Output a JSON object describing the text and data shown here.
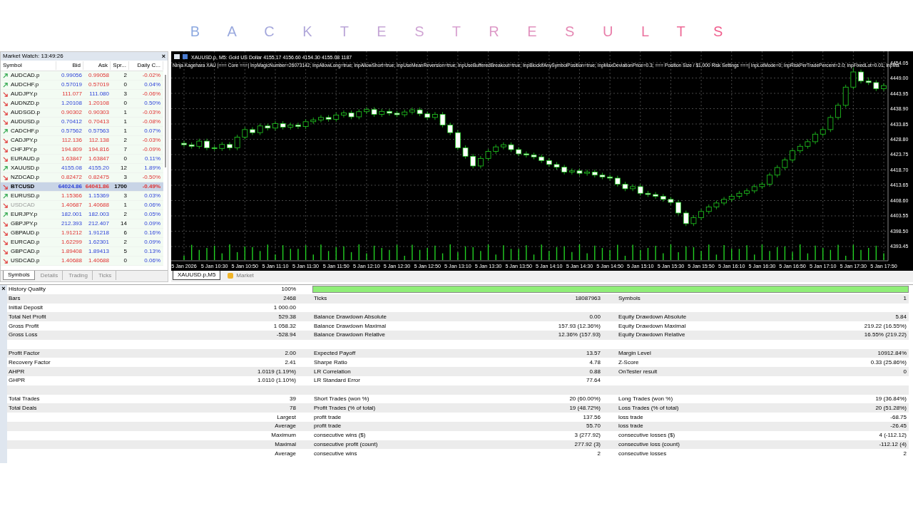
{
  "page_title": "B A C K T E S T R E S U L T S",
  "market_watch": {
    "title": "Market Watch: 13:49:26",
    "close": "×",
    "columns": [
      "Symbol",
      "Bid",
      "Ask",
      "Spr...",
      "Daily C..."
    ],
    "rows": [
      {
        "symbol": "AUDCAD.p",
        "bid": "0.99056",
        "ask": "0.99058",
        "spread": "2",
        "change": "-0.02%",
        "trend_up": true,
        "bid_up": true,
        "ask_up": false,
        "change_up": false,
        "selected": false,
        "dimmed": false
      },
      {
        "symbol": "AUDCHF.p",
        "bid": "0.57019",
        "ask": "0.57019",
        "spread": "0",
        "change": "0.04%",
        "trend_up": true,
        "bid_up": true,
        "ask_up": false,
        "change_up": true,
        "selected": false,
        "dimmed": false
      },
      {
        "symbol": "AUDJPY.p",
        "bid": "111.077",
        "ask": "111.080",
        "spread": "3",
        "change": "-0.06%",
        "trend_up": false,
        "bid_up": false,
        "ask_up": true,
        "change_up": false,
        "selected": false,
        "dimmed": false
      },
      {
        "symbol": "AUDNZD.p",
        "bid": "1.20108",
        "ask": "1.20108",
        "spread": "0",
        "change": "0.50%",
        "trend_up": false,
        "bid_up": true,
        "ask_up": false,
        "change_up": true,
        "selected": false,
        "dimmed": false
      },
      {
        "symbol": "AUDSGD.p",
        "bid": "0.90302",
        "ask": "0.90303",
        "spread": "1",
        "change": "-0.03%",
        "trend_up": false,
        "bid_up": false,
        "ask_up": false,
        "change_up": false,
        "selected": false,
        "dimmed": false
      },
      {
        "symbol": "AUDUSD.p",
        "bid": "0.70412",
        "ask": "0.70413",
        "spread": "1",
        "change": "-0.08%",
        "trend_up": false,
        "bid_up": true,
        "ask_up": false,
        "change_up": false,
        "selected": false,
        "dimmed": false
      },
      {
        "symbol": "CADCHF.p",
        "bid": "0.57562",
        "ask": "0.57563",
        "spread": "1",
        "change": "0.07%",
        "trend_up": true,
        "bid_up": true,
        "ask_up": true,
        "change_up": true,
        "selected": false,
        "dimmed": false
      },
      {
        "symbol": "CADJPY.p",
        "bid": "112.136",
        "ask": "112.138",
        "spread": "2",
        "change": "-0.03%",
        "trend_up": false,
        "bid_up": false,
        "ask_up": false,
        "change_up": false,
        "selected": false,
        "dimmed": false
      },
      {
        "symbol": "CHFJPY.p",
        "bid": "194.809",
        "ask": "194.816",
        "spread": "7",
        "change": "-0.09%",
        "trend_up": false,
        "bid_up": false,
        "ask_up": false,
        "change_up": false,
        "selected": false,
        "dimmed": false
      },
      {
        "symbol": "EURAUD.p",
        "bid": "1.63847",
        "ask": "1.63847",
        "spread": "0",
        "change": "0.11%",
        "trend_up": false,
        "bid_up": false,
        "ask_up": false,
        "change_up": true,
        "selected": false,
        "dimmed": false
      },
      {
        "symbol": "XAUUSD.p",
        "bid": "4155.08",
        "ask": "4155.20",
        "spread": "12",
        "change": "1.89%",
        "trend_up": true,
        "bid_up": true,
        "ask_up": true,
        "change_up": true,
        "selected": false,
        "dimmed": false
      },
      {
        "symbol": "NZDCAD.p",
        "bid": "0.82472",
        "ask": "0.82475",
        "spread": "3",
        "change": "-0.50%",
        "trend_up": false,
        "bid_up": false,
        "ask_up": false,
        "change_up": false,
        "selected": false,
        "dimmed": false
      },
      {
        "symbol": "BTCUSD",
        "bid": "64024.86",
        "ask": "64041.86",
        "spread": "1700",
        "change": "-0.49%",
        "trend_up": false,
        "bid_up": true,
        "ask_up": false,
        "change_up": false,
        "selected": true,
        "dimmed": false
      },
      {
        "symbol": "EURUSD.p",
        "bid": "1.15366",
        "ask": "1.15369",
        "spread": "3",
        "change": "0.03%",
        "trend_up": true,
        "bid_up": false,
        "ask_up": true,
        "change_up": true,
        "selected": false,
        "dimmed": false
      },
      {
        "symbol": "USDCAD",
        "bid": "1.40687",
        "ask": "1.40688",
        "spread": "1",
        "change": "0.06%",
        "trend_up": false,
        "bid_up": false,
        "ask_up": false,
        "change_up": true,
        "selected": false,
        "dimmed": true
      },
      {
        "symbol": "EURJPY.p",
        "bid": "182.001",
        "ask": "182.003",
        "spread": "2",
        "change": "0.05%",
        "trend_up": true,
        "bid_up": true,
        "ask_up": true,
        "change_up": true,
        "selected": false,
        "dimmed": false
      },
      {
        "symbol": "GBPJPY.p",
        "bid": "212.393",
        "ask": "212.407",
        "spread": "14",
        "change": "0.09%",
        "trend_up": false,
        "bid_up": true,
        "ask_up": true,
        "change_up": true,
        "selected": false,
        "dimmed": false
      },
      {
        "symbol": "GBPAUD.p",
        "bid": "1.91212",
        "ask": "1.91218",
        "spread": "6",
        "change": "0.16%",
        "trend_up": false,
        "bid_up": false,
        "ask_up": true,
        "change_up": true,
        "selected": false,
        "dimmed": false
      },
      {
        "symbol": "EURCAD.p",
        "bid": "1.62299",
        "ask": "1.62301",
        "spread": "2",
        "change": "0.09%",
        "trend_up": false,
        "bid_up": false,
        "ask_up": true,
        "change_up": true,
        "selected": false,
        "dimmed": false
      },
      {
        "symbol": "GBPCAD.p",
        "bid": "1.89408",
        "ask": "1.89413",
        "spread": "5",
        "change": "0.13%",
        "trend_up": false,
        "bid_up": false,
        "ask_up": true,
        "change_up": true,
        "selected": false,
        "dimmed": false
      },
      {
        "symbol": "USDCAD.p",
        "bid": "1.40688",
        "ask": "1.40688",
        "spread": "0",
        "change": "0.06%",
        "trend_up": false,
        "bid_up": false,
        "ask_up": false,
        "change_up": true,
        "selected": false,
        "dimmed": false
      }
    ],
    "tabs": [
      {
        "label": "Symbols",
        "selected": true
      },
      {
        "label": "Details",
        "selected": false
      },
      {
        "label": "Trading",
        "selected": false
      },
      {
        "label": "Ticks",
        "selected": false
      }
    ]
  },
  "chart": {
    "header": "XAUUSD.p, M5:  Gold US Dollar  4155.17 4156.60 4154.30 4155.08  1187",
    "params": "Ninja Kagehara XAU |=== Core ===| InpMagicNumber=26073142; InpAllowLong=true; InpAllowShort=true; InpUseMeanReversion=true; InpUseBufferedBreakout=true; InpBlockIfAnySymbolPosition=true; InpMaxDeviationPrice=0.3; === Position Size / $1,000 Risk Settings ===| InpLotMode=0; InpRiskPerTradePercent=2.0; InpFixedLot=0.01; InpMa",
    "chart_data": {
      "type": "candlestick",
      "grid": true,
      "ylim": [
        4388.75,
        4457.81
      ],
      "categories": [
        "5 Jan 2026",
        null,
        null,
        null,
        "5 Jan 10:30",
        null,
        null,
        null,
        "5 Jan 10:50",
        null,
        null,
        null,
        "5 Jan 11:10",
        null,
        null,
        null,
        "5 Jan 11:30",
        null,
        null,
        null,
        "5 Jan 11:50",
        null,
        null,
        null,
        "5 Jan 12:10",
        null,
        null,
        null,
        "5 Jan 12:30",
        null,
        null,
        null,
        "5 Jan 12:50",
        null,
        null,
        null,
        "5 Jan 13:10",
        null,
        null,
        null,
        "5 Jan 13:30",
        null,
        null,
        null,
        "5 Jan 13:50",
        null,
        null,
        null,
        "5 Jan 14:10",
        null,
        null,
        null,
        "5 Jan 14:30",
        null,
        null,
        null,
        "5 Jan 14:50",
        null,
        null,
        null,
        "5 Jan 15:10",
        null,
        null,
        null,
        "5 Jan 15:30",
        null,
        null,
        null,
        "5 Jan 15:50",
        null,
        null,
        null,
        "5 Jan 16:10",
        null,
        null,
        null,
        "5 Jan 16:30",
        null,
        null,
        null,
        "5 Jan 16:50",
        null,
        null,
        null,
        "5 Jan 17:10",
        null,
        null,
        null,
        "5 Jan 17:30",
        null,
        null,
        null,
        "5 Jan 17:50"
      ],
      "yticks": [
        {
          "value": 4454.05,
          "label": "4454.05"
        },
        {
          "value": 4449.0,
          "label": "4449.00"
        },
        {
          "value": 4443.95,
          "label": "4443.95"
        },
        {
          "value": 4438.9,
          "label": "4438.90"
        },
        {
          "value": 4433.85,
          "label": "4433.85"
        },
        {
          "value": 4428.8,
          "label": "4428.80"
        },
        {
          "value": 4423.75,
          "label": "4423.75"
        },
        {
          "value": 4418.7,
          "label": "4418.70"
        },
        {
          "value": 4413.65,
          "label": "4413.65"
        },
        {
          "value": 4408.6,
          "label": "4408.60"
        },
        {
          "value": 4403.55,
          "label": "4403.55"
        },
        {
          "value": 4398.5,
          "label": "4398.50"
        },
        {
          "value": 4393.45,
          "label": "4393.45"
        }
      ],
      "ohlc": [
        [
          4427.5,
          4428.3,
          4426.2,
          4427.0
        ],
        [
          4427.0,
          4427.8,
          4425.7,
          4426.5
        ],
        [
          4426.5,
          4429.0,
          4425.7,
          4428.2
        ],
        [
          4428.2,
          4429.0,
          4425.2,
          4426.0
        ],
        [
          4426.0,
          4426.8,
          4425.0,
          4425.8
        ],
        [
          4425.8,
          4427.9,
          4425.0,
          4427.1
        ],
        [
          4427.1,
          4427.9,
          4425.2,
          4426.0
        ],
        [
          4426.0,
          4430.3,
          4425.2,
          4429.5
        ],
        [
          4429.5,
          4432.8,
          4428.7,
          4432.0
        ],
        [
          4432.0,
          4432.8,
          4430.2,
          4431.0
        ],
        [
          4431.0,
          4434.0,
          4430.2,
          4433.2
        ],
        [
          4433.2,
          4434.0,
          4431.7,
          4432.5
        ],
        [
          4432.5,
          4434.8,
          4431.7,
          4434.0
        ],
        [
          4434.0,
          4434.8,
          4432.0,
          4432.8
        ],
        [
          4432.8,
          4434.3,
          4432.0,
          4433.5
        ],
        [
          4433.5,
          4434.3,
          4432.2,
          4433.0
        ],
        [
          4433.0,
          4435.4,
          4432.2,
          4434.6
        ],
        [
          4434.6,
          4436.0,
          4433.8,
          4435.2
        ],
        [
          4435.2,
          4436.8,
          4434.4,
          4436.0
        ],
        [
          4436.0,
          4436.8,
          4434.6,
          4435.4
        ],
        [
          4435.4,
          4437.6,
          4434.6,
          4436.8
        ],
        [
          4436.8,
          4438.3,
          4436.0,
          4437.5
        ],
        [
          4437.5,
          4438.3,
          4435.4,
          4436.2
        ],
        [
          4436.2,
          4438.7,
          4435.4,
          4437.9
        ],
        [
          4437.9,
          4439.4,
          4437.1,
          4438.6
        ],
        [
          4438.6,
          4439.4,
          4436.2,
          4437.0
        ],
        [
          4437.0,
          4438.8,
          4436.2,
          4438.0
        ],
        [
          4438.0,
          4438.8,
          4436.6,
          4437.4
        ],
        [
          4437.4,
          4438.2,
          4436.1,
          4436.9
        ],
        [
          4436.9,
          4438.6,
          4436.1,
          4437.8
        ],
        [
          4437.8,
          4439.3,
          4437.0,
          4438.5
        ],
        [
          4438.5,
          4439.3,
          4436.4,
          4437.2
        ],
        [
          4437.2,
          4438.0,
          4435.2,
          4436.0
        ],
        [
          4436.0,
          4437.8,
          4435.2,
          4437.0
        ],
        [
          4437.0,
          4437.8,
          4432.7,
          4433.5
        ],
        [
          4433.5,
          4434.3,
          4430.2,
          4431.0
        ],
        [
          4431.0,
          4431.8,
          4425.2,
          4426.0
        ],
        [
          4426.0,
          4426.8,
          4422.4,
          4423.2
        ],
        [
          4423.2,
          4424.0,
          4419.2,
          4420.0
        ],
        [
          4420.0,
          4423.3,
          4419.2,
          4422.5
        ],
        [
          4422.5,
          4425.6,
          4421.7,
          4424.8
        ],
        [
          4424.8,
          4427.1,
          4424.0,
          4426.3
        ],
        [
          4426.3,
          4427.8,
          4425.5,
          4427.0
        ],
        [
          4427.0,
          4427.8,
          4424.6,
          4425.4
        ],
        [
          4425.4,
          4426.2,
          4423.2,
          4424.0
        ],
        [
          4424.0,
          4424.8,
          4422.8,
          4423.6
        ],
        [
          4423.6,
          4424.4,
          4422.2,
          4423.0
        ],
        [
          4423.0,
          4423.8,
          4421.0,
          4421.8
        ],
        [
          4421.8,
          4422.6,
          4419.7,
          4420.5
        ],
        [
          4420.5,
          4421.3,
          4418.8,
          4419.6
        ],
        [
          4419.6,
          4420.4,
          4417.2,
          4418.0
        ],
        [
          4418.0,
          4419.2,
          4417.2,
          4418.4
        ],
        [
          4418.4,
          4419.2,
          4416.8,
          4417.6
        ],
        [
          4417.6,
          4418.8,
          4416.8,
          4418.0
        ],
        [
          4418.0,
          4418.8,
          4416.2,
          4417.0
        ],
        [
          4417.0,
          4417.8,
          4415.6,
          4416.4
        ],
        [
          4416.4,
          4417.2,
          4415.2,
          4416.0
        ],
        [
          4416.0,
          4416.8,
          4413.2,
          4414.0
        ],
        [
          4414.0,
          4414.8,
          4411.7,
          4412.5
        ],
        [
          4412.5,
          4414.0,
          4411.7,
          4413.2
        ],
        [
          4413.2,
          4414.0,
          4410.2,
          4411.0
        ],
        [
          4411.0,
          4411.8,
          4409.8,
          4410.6
        ],
        [
          4410.6,
          4411.4,
          4409.2,
          4410.0
        ],
        [
          4410.0,
          4410.8,
          4408.2,
          4409.0
        ],
        [
          4409.0,
          4409.8,
          4407.2,
          4408.0
        ],
        [
          4408.0,
          4408.8,
          4403.7,
          4404.5
        ],
        [
          4404.5,
          4405.3,
          4400.2,
          4401.0
        ],
        [
          4401.0,
          4403.8,
          4400.2,
          4403.0
        ],
        [
          4403.0,
          4405.8,
          4402.2,
          4405.0
        ],
        [
          4405.0,
          4407.3,
          4404.2,
          4406.5
        ],
        [
          4406.5,
          4408.6,
          4405.7,
          4407.8
        ],
        [
          4407.8,
          4409.8,
          4407.0,
          4409.0
        ],
        [
          4409.0,
          4410.8,
          4408.2,
          4410.0
        ],
        [
          4410.0,
          4411.8,
          4409.2,
          4411.0
        ],
        [
          4411.0,
          4412.6,
          4410.2,
          4411.8
        ],
        [
          4411.8,
          4414.0,
          4411.0,
          4413.2
        ],
        [
          4413.2,
          4414.8,
          4412.4,
          4414.0
        ],
        [
          4414.0,
          4417.8,
          4413.2,
          4417.0
        ],
        [
          4417.0,
          4420.3,
          4416.2,
          4419.5
        ],
        [
          4419.5,
          4422.8,
          4418.7,
          4422.0
        ],
        [
          4422.0,
          4425.8,
          4421.2,
          4425.0
        ],
        [
          4425.0,
          4427.3,
          4424.2,
          4426.5
        ],
        [
          4426.5,
          4428.8,
          4425.7,
          4428.0
        ],
        [
          4428.0,
          4431.3,
          4427.2,
          4430.5
        ],
        [
          4430.5,
          4432.8,
          4429.7,
          4432.0
        ],
        [
          4432.0,
          4436.8,
          4431.2,
          4436.0
        ],
        [
          4436.0,
          4440.8,
          4435.2,
          4440.0
        ],
        [
          4440.0,
          4446.8,
          4439.2,
          4446.0
        ],
        [
          4446.0,
          4452.5,
          4445.2,
          4451.0
        ],
        [
          4451.0,
          4451.8,
          4447.2,
          4448.0
        ],
        [
          4448.0,
          4449.2,
          4446.7,
          4447.5
        ],
        [
          4447.5,
          4448.3,
          4444.7,
          4445.5
        ],
        [
          4445.5,
          4447.3,
          4444.7,
          4446.5
        ]
      ]
    },
    "tabs": [
      {
        "label": "XAUUSD.p,M5",
        "kind": "chart",
        "selected": true
      },
      {
        "label": "Market",
        "kind": "market",
        "selected": false
      }
    ]
  },
  "report": {
    "close": "×",
    "rows": [
      {
        "kind": "quality",
        "label": "History Quality",
        "value": "100%",
        "level": 1
      },
      {
        "kind": "data",
        "cells": [
          {
            "label": "Bars",
            "value": "2468"
          },
          {
            "label": "Ticks",
            "value": "18087963"
          },
          {
            "label": "Symbols",
            "value": "1"
          }
        ]
      },
      {
        "kind": "data",
        "cells": [
          {
            "label": "Initial Deposit",
            "value": "1 000.00"
          },
          {},
          {}
        ]
      },
      {
        "kind": "data",
        "cells": [
          {
            "label": "Total Net Profit",
            "value": "529.38"
          },
          {
            "label": "Balance Drawdown Absolute",
            "value": "0.00"
          },
          {
            "label": "Equity Drawdown Absolute",
            "value": "5.84"
          }
        ]
      },
      {
        "kind": "data",
        "cells": [
          {
            "label": "Gross Profit",
            "value": "1 058.32"
          },
          {
            "label": "Balance Drawdown Maximal",
            "value": "157.93 (12.36%)"
          },
          {
            "label": "Equity Drawdown Maximal",
            "value": "219.22 (16.55%)"
          }
        ]
      },
      {
        "kind": "data",
        "cells": [
          {
            "label": "Gross Loss",
            "value": "-528.94"
          },
          {
            "label": "Balance Drawdown Relative",
            "value": "12.36% (157.93)"
          },
          {
            "label": "Equity Drawdown Relative",
            "value": "16.55% (219.22)"
          }
        ]
      },
      {
        "kind": "blank"
      },
      {
        "kind": "data",
        "cells": [
          {
            "label": "Profit Factor",
            "value": "2.00"
          },
          {
            "label": "Expected Payoff",
            "value": "13.57"
          },
          {
            "label": "Margin Level",
            "value": "10912.84%"
          }
        ]
      },
      {
        "kind": "data",
        "cells": [
          {
            "label": "Recovery Factor",
            "value": "2.41"
          },
          {
            "label": "Sharpe Ratio",
            "value": "4.78"
          },
          {
            "label": "Z-Score",
            "value": "0.33 (25.86%)"
          }
        ]
      },
      {
        "kind": "data",
        "cells": [
          {
            "label": "AHPR",
            "value": "1.0119 (1.19%)"
          },
          {
            "label": "LR Correlation",
            "value": "0.88"
          },
          {
            "label": "OnTester result",
            "value": "0"
          }
        ]
      },
      {
        "kind": "data",
        "cells": [
          {
            "label": "GHPR",
            "value": "1.0110 (1.10%)"
          },
          {
            "label": "LR Standard Error",
            "value": "77.64"
          },
          {}
        ]
      },
      {
        "kind": "blank"
      },
      {
        "kind": "data",
        "cells": [
          {
            "label": "Total Trades",
            "value": "39"
          },
          {
            "label": "Short Trades (won %)",
            "value": "20 (60.00%)"
          },
          {
            "label": "Long Trades (won %)",
            "value": "19 (36.84%)"
          }
        ]
      },
      {
        "kind": "data",
        "cells": [
          {
            "label": "Total Deals",
            "value": "78"
          },
          {
            "label": "Profit Trades (% of total)",
            "value": "19 (48.72%)"
          },
          {
            "label": "Loss Trades (% of total)",
            "value": "20 (51.28%)"
          }
        ]
      },
      {
        "kind": "data",
        "cells": [
          {
            "value": "Largest"
          },
          {
            "label": "profit trade",
            "value": "137.56"
          },
          {
            "label": "loss trade",
            "value": "-68.75"
          }
        ]
      },
      {
        "kind": "data",
        "cells": [
          {
            "value": "Average"
          },
          {
            "label": "profit trade",
            "value": "55.70"
          },
          {
            "label": "loss trade",
            "value": "-26.45"
          }
        ]
      },
      {
        "kind": "data",
        "cells": [
          {
            "value": "Maximum"
          },
          {
            "label": "consecutive wins ($)",
            "value": "3 (277.92)"
          },
          {
            "label": "consecutive losses ($)",
            "value": "4 (-112.12)"
          }
        ]
      },
      {
        "kind": "data",
        "cells": [
          {
            "value": "Maximal"
          },
          {
            "label": "consecutive profit (count)",
            "value": "277.92 (3)"
          },
          {
            "label": "consecutive loss (count)",
            "value": "-112.12 (4)"
          }
        ]
      },
      {
        "kind": "data",
        "cells": [
          {
            "value": "Average"
          },
          {
            "label": "consecutive wins",
            "value": "2"
          },
          {
            "label": "consecutive losses",
            "value": "2"
          }
        ]
      }
    ]
  }
}
